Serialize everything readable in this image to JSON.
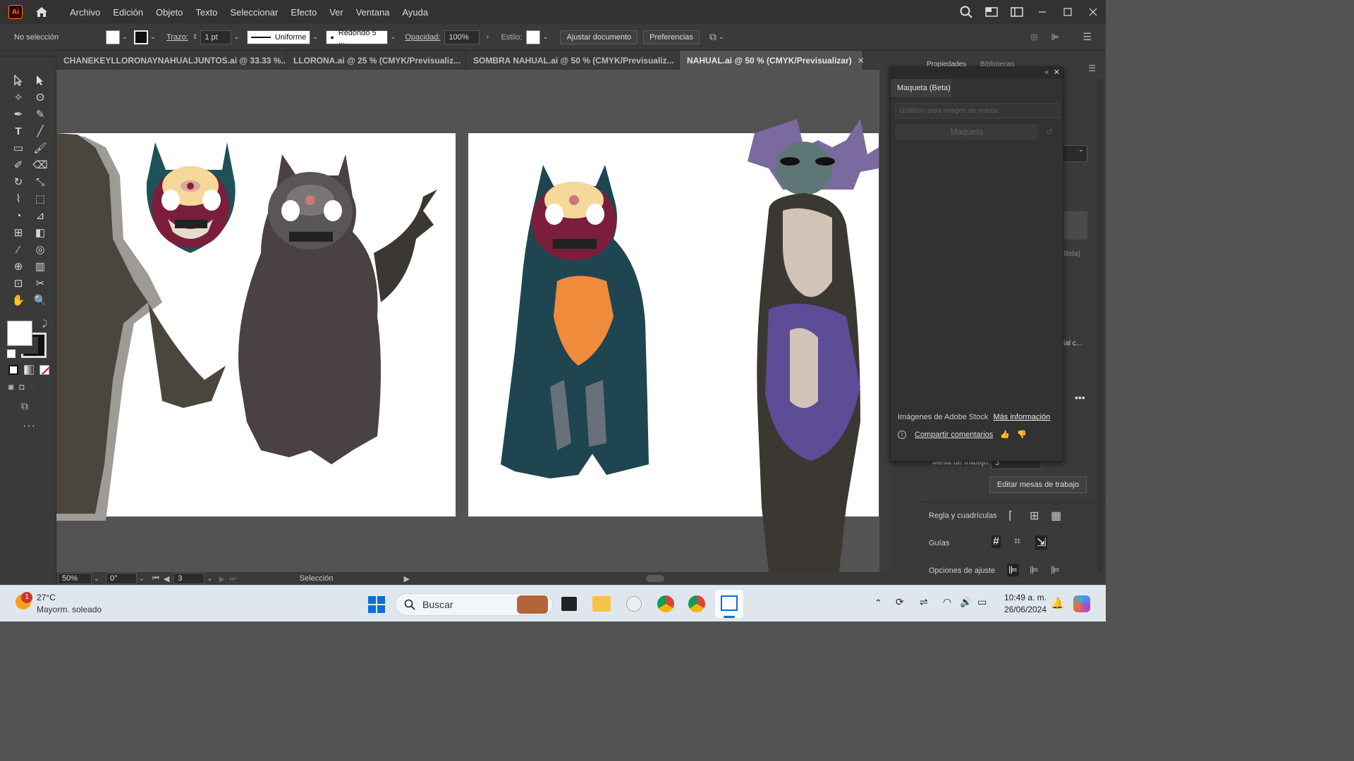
{
  "app": {
    "logo": "Ai"
  },
  "menu": [
    "Archivo",
    "Edición",
    "Objeto",
    "Texto",
    "Seleccionar",
    "Efecto",
    "Ver",
    "Ventana",
    "Ayuda"
  ],
  "control": {
    "selection": "No selección",
    "stroke_label": "Trazo:",
    "stroke_value": "1 pt",
    "profile": "Uniforme",
    "brush": "Redondo 5 ...",
    "opacity_label": "Opacidad:",
    "opacity_value": "100%",
    "style_label": "Estilo:",
    "fit_button": "Ajustar documento",
    "prefs_button": "Preferencias"
  },
  "tabs": [
    {
      "label": "CHANEKEYLLORONAYNAHUALJUNTOS.ai @ 33.33 %...",
      "active": false
    },
    {
      "label": "LLORONA.ai @ 25 % (CMYK/Previsualiz...",
      "active": false
    },
    {
      "label": "SOMBRA NAHUAL.ai @ 50 % (CMYK/Previsualiz...",
      "active": false
    },
    {
      "label": "NAHUAL.ai @ 50 % (CMYK/Previsualizar)",
      "active": true
    }
  ],
  "tab_close": "✕",
  "status": {
    "zoom": "50%",
    "rotation": "0°",
    "artboard": "3",
    "tool": "Selección"
  },
  "panel": {
    "tab_props": "Propiedades",
    "tab_libs": "Bibliotecas",
    "artboard_label": "Mesa de trabajo:",
    "artboard_value": "3",
    "edit_artboards": "Editar mesas de trabajo",
    "rulers_grids": "Regla y cuadrículas",
    "guides": "Guías",
    "snap_options": "Opciones de ajuste",
    "beta_fragment": "Beta)",
    "cut_fragment": "ial c..."
  },
  "maqueta": {
    "tab": "Maqueta (Beta)",
    "select_placeholder": "Gráficos para imagen de marca",
    "button": "Maqueta",
    "stock_text": "Imágenes de Adobe Stock",
    "more_info": "Más información",
    "share": "Compartir comentarios"
  },
  "taskbar": {
    "temp": "27°C",
    "weather": "Mayorm. soleado",
    "weather_badge": "1",
    "search": "Buscar",
    "time": "10:49 a. m.",
    "date": "26/06/2024"
  },
  "colors": {
    "teal": "#1f4650",
    "orange": "#f08b3c",
    "purple": "#5d4c96",
    "gray_bear": "#4a4143",
    "dark": "#3b3833",
    "cream": "#d1c4b6"
  }
}
